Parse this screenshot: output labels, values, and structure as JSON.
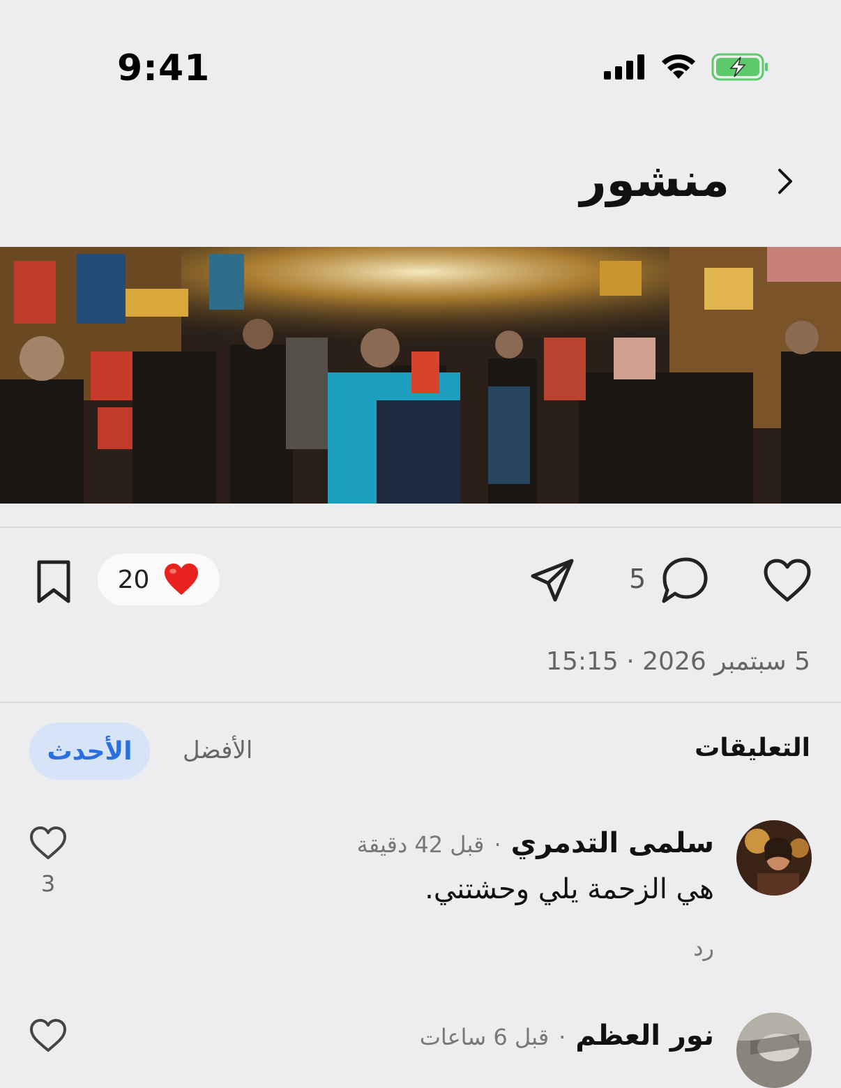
{
  "status_bar": {
    "time": "9:41"
  },
  "header": {
    "title": "منشور"
  },
  "actions": {
    "reaction_count": "20",
    "reaction_emoji": "❤️",
    "comment_count": "5"
  },
  "post": {
    "datetime": "5 سبتمبر 2026 · 15:15"
  },
  "comments_section": {
    "label": "التعليقات",
    "tab_best": "الأفضل",
    "tab_newest": "الأحدث"
  },
  "comments": [
    {
      "name": "سلمى التدمري",
      "time": "قبل 42 دقيقة",
      "text": "هي الزحمة يلي وحشتني.",
      "reply": "رد",
      "likes": "3"
    },
    {
      "name": "نور العظم",
      "time": "قبل 6 ساعات"
    }
  ]
}
